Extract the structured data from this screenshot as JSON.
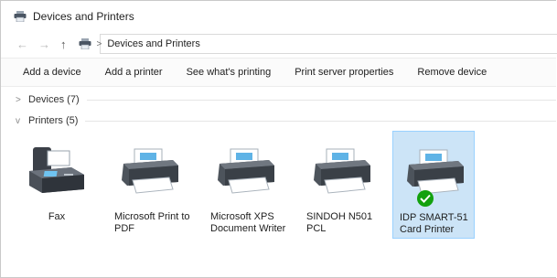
{
  "window": {
    "title": "Devices and Printers",
    "title_icon": "devices-printers-icon"
  },
  "address": {
    "back_glyph": "←",
    "forward_glyph": "→",
    "up_glyph": "↑",
    "crumb_separator": ">",
    "location": "Devices and Printers"
  },
  "toolbar": {
    "add_device": "Add a device",
    "add_printer": "Add a printer",
    "see_printing": "See what's printing",
    "print_server": "Print server properties",
    "remove_device": "Remove device"
  },
  "groups": {
    "devices": {
      "chevron": ">",
      "label": "Devices (7)"
    },
    "printers": {
      "chevron": "v",
      "label": "Printers (5)"
    }
  },
  "printers": [
    {
      "name": "Fax",
      "icon": "fax-icon"
    },
    {
      "name": "Microsoft Print to PDF",
      "line1": "Microsoft Print to",
      "line2": "PDF",
      "icon": "printer-icon"
    },
    {
      "name": "Microsoft XPS Document Writer",
      "line1": "Microsoft XPS",
      "line2": "Document Writer",
      "icon": "printer-icon"
    },
    {
      "name": "SINDOH N501 PCL",
      "line1": "SINDOH N501",
      "line2": "PCL",
      "icon": "printer-icon"
    },
    {
      "name": "IDP SMART-51 Card Printer",
      "line1": "IDP SMART-51",
      "line2": "Card Printer",
      "icon": "printer-icon",
      "default": true,
      "selected": true
    }
  ],
  "colors": {
    "selection_fill": "#cce4f7",
    "selection_border": "#99d1ff",
    "default_check": "#13a10e"
  }
}
